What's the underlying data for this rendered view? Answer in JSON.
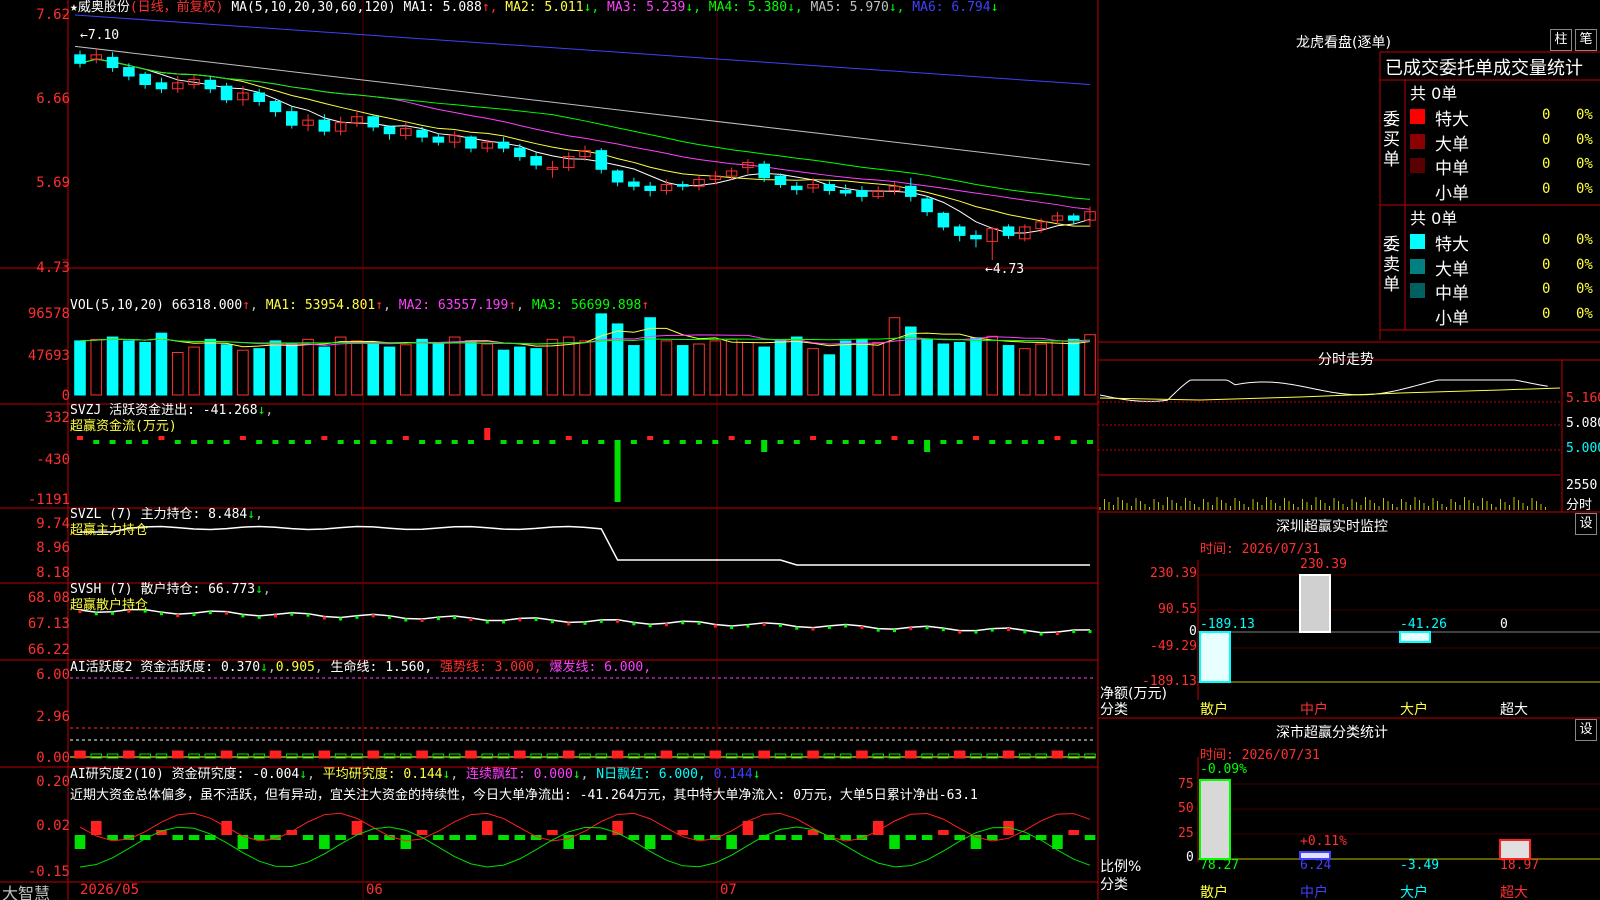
{
  "stock": {
    "star": "★",
    "name": "威奥股份",
    "period": "(日线，前复权)"
  },
  "ma_header": {
    "label": "MA(5,10,20,30,60,120)",
    "items": [
      {
        "k": "MA1:",
        "v": "5.088",
        "arrow": "↑",
        "color": "#ffffff"
      },
      {
        "k": "MA2:",
        "v": "5.011",
        "arrow": "↓",
        "color": "#ffff40"
      },
      {
        "k": "MA3:",
        "v": "5.239",
        "arrow": "↓",
        "color": "#ff40ff"
      },
      {
        "k": "MA4:",
        "v": "5.380",
        "arrow": "↓",
        "color": "#00ff00"
      },
      {
        "k": "MA5:",
        "v": "5.970",
        "arrow": "↓",
        "color": "#c0c0c0"
      },
      {
        "k": "MA6:",
        "v": "6.794",
        "arrow": "↓",
        "color": "#4040ff"
      }
    ]
  },
  "price_axis": [
    "7.62",
    "6.66",
    "5.69",
    "4.73"
  ],
  "hi_marker": "←7.10",
  "lo_marker": "←4.73",
  "vol_header": {
    "label": "VOL(5,10,20)",
    "v": "66318.000",
    "ma1": "MA1:  53954.801",
    "ma2": "MA2:  63557.199",
    "ma3": "MA3:  56699.898",
    "arrow": "↑"
  },
  "vol_axis": [
    "96578",
    "47693",
    "0"
  ],
  "svzj": {
    "title": "SVZJ  活跃资金进出: -41.268",
    "arrow": "↓",
    "sub": "超赢资金流(万元)",
    "axis": [
      "332",
      "-430",
      "-1191"
    ]
  },
  "svzl": {
    "title": "SVZL (7) 主力持仓: 8.484",
    "arrow": "↓",
    "sub": "超赢主力持仓",
    "axis": [
      "9.74",
      "8.96",
      "8.18"
    ]
  },
  "svsh": {
    "title": "SVSH (7) 散户持仓: 66.773",
    "arrow": "↓",
    "sub": "超赢散户持仓",
    "axis": [
      "68.08",
      "67.13",
      "66.22"
    ]
  },
  "ai1": {
    "title": "AI活跃度2 资金活跃度: 0.370",
    "a1": "↓",
    "v2": "0.905",
    "t3": "生命线: 1.560,",
    "t4": "强势线: 3.000,",
    "t5": "爆发线: 6.000,",
    "axis": [
      "6.00",
      "2.96",
      "0.00"
    ]
  },
  "ai2": {
    "title": "AI研究度2(10) 资金研究度: -0.004",
    "a1": "↓",
    "t2": "平均研究度: 0.144",
    "a2": "↓",
    "t3": "连续飘红: 0.000",
    "a3": "↓",
    "t4": "N日飘红: 6.000,",
    "t5": "0.144",
    "a5": "↓",
    "text": "近期大资金总体偏多，虽不活跃，但有异动，宜关注大资金的持续性，今日大单净流出: -41.264万元，其中特大单净流入: 0万元，大单5日累计净出-63.1",
    "axis": [
      "0.20",
      "0.02",
      "-0.15"
    ]
  },
  "dates": [
    "2026/05",
    "06",
    "07"
  ],
  "brand": "大智慧",
  "lhb": {
    "title": "龙虎看盘(逐单)",
    "btn1": "柱",
    "btn2": "笔",
    "heading": "已成交委托单成交量统计",
    "buy": {
      "label": "委买单",
      "total": "共 0单",
      "rows": [
        {
          "n": "特大",
          "c": "#ff0000",
          "q": "0",
          "p": "0%"
        },
        {
          "n": "大单",
          "c": "#8b0000",
          "q": "0",
          "p": "0%"
        },
        {
          "n": "中单",
          "c": "#5a0000",
          "q": "0",
          "p": "0%"
        },
        {
          "n": "小单",
          "c": "#000000",
          "q": "0",
          "p": "0%"
        }
      ]
    },
    "sell": {
      "label": "委卖单",
      "total": "共 0单",
      "rows": [
        {
          "n": "特大",
          "c": "#00ffff",
          "q": "0",
          "p": "0%"
        },
        {
          "n": "大单",
          "c": "#008080",
          "q": "0",
          "p": "0%"
        },
        {
          "n": "中单",
          "c": "#006060",
          "q": "0",
          "p": "0%"
        },
        {
          "n": "小单",
          "c": "#000000",
          "q": "0",
          "p": "0%"
        }
      ]
    }
  },
  "intraday": {
    "title": "分时走势",
    "axis": [
      "5.160",
      "5.080",
      "5.000"
    ],
    "vol": "2550",
    "vol_unit": "分时"
  },
  "monitor": {
    "title": "深圳超赢实时监控",
    "btn": "设",
    "time": "时间: 2026/07/31",
    "axis": [
      "230.39",
      "90.55",
      "0",
      "-49.29",
      "-189.13"
    ],
    "unit1": "净额(万元)",
    "unit2": "分类",
    "bars": [
      {
        "cat": "散户",
        "v": "-189.13"
      },
      {
        "cat": "中户",
        "v": "230.39"
      },
      {
        "cat": "大户",
        "v": "-41.26"
      },
      {
        "cat": "超大",
        "v": "0"
      }
    ]
  },
  "stat": {
    "title": "深市超赢分类统计",
    "btn": "设",
    "time": "时间: 2026/07/31",
    "axis": [
      "75",
      "50",
      "25",
      "0"
    ],
    "unit1": "比例%",
    "unit2": "分类",
    "top": [
      "-0.09%",
      "+0.11%"
    ],
    "bars": [
      {
        "cat": "散户",
        "v": "78.27"
      },
      {
        "cat": "中户",
        "v": "6.24"
      },
      {
        "cat": "大户",
        "v": "-3.49"
      },
      {
        "cat": "超大",
        "v": "18.97"
      }
    ]
  },
  "colors": {
    "up": "#ff3030",
    "down": "#00ffff",
    "grid": "#c00000",
    "ma1": "#ffffff",
    "ma2": "#ffff40",
    "ma3": "#ff40ff",
    "ma4": "#00ff00",
    "ma5": "#c0c0c0",
    "ma6": "#4040ff"
  },
  "chart_data": {
    "type": "candlestick",
    "title": "威奥股份",
    "ylim": [
      4.73,
      7.62
    ],
    "candles": [
      {
        "o": 7.15,
        "c": 7.05,
        "h": 7.2,
        "l": 7.0
      },
      {
        "o": 7.1,
        "c": 7.15,
        "h": 7.22,
        "l": 7.05
      },
      {
        "o": 7.12,
        "c": 7.0,
        "h": 7.18,
        "l": 6.95
      },
      {
        "o": 7.0,
        "c": 6.9,
        "h": 7.05,
        "l": 6.85
      },
      {
        "o": 6.92,
        "c": 6.8,
        "h": 6.95,
        "l": 6.75
      },
      {
        "o": 6.82,
        "c": 6.75,
        "h": 6.88,
        "l": 6.7
      },
      {
        "o": 6.75,
        "c": 6.82,
        "h": 6.9,
        "l": 6.7
      },
      {
        "o": 6.8,
        "c": 6.86,
        "h": 6.92,
        "l": 6.75
      },
      {
        "o": 6.85,
        "c": 6.75,
        "h": 6.9,
        "l": 6.7
      },
      {
        "o": 6.78,
        "c": 6.62,
        "h": 6.82,
        "l": 6.58
      },
      {
        "o": 6.62,
        "c": 6.7,
        "h": 6.78,
        "l": 6.55
      },
      {
        "o": 6.7,
        "c": 6.6,
        "h": 6.75,
        "l": 6.55
      },
      {
        "o": 6.6,
        "c": 6.48,
        "h": 6.62,
        "l": 6.42
      },
      {
        "o": 6.48,
        "c": 6.32,
        "h": 6.55,
        "l": 6.28
      },
      {
        "o": 6.32,
        "c": 6.38,
        "h": 6.45,
        "l": 6.25
      },
      {
        "o": 6.38,
        "c": 6.25,
        "h": 6.45,
        "l": 6.2
      },
      {
        "o": 6.25,
        "c": 6.35,
        "h": 6.42,
        "l": 6.2
      },
      {
        "o": 6.35,
        "c": 6.42,
        "h": 6.5,
        "l": 6.3
      },
      {
        "o": 6.42,
        "c": 6.3,
        "h": 6.45,
        "l": 6.25
      },
      {
        "o": 6.3,
        "c": 6.22,
        "h": 6.32,
        "l": 6.15
      },
      {
        "o": 6.2,
        "c": 6.28,
        "h": 6.35,
        "l": 6.15
      },
      {
        "o": 6.26,
        "c": 6.18,
        "h": 6.3,
        "l": 6.12
      },
      {
        "o": 6.18,
        "c": 6.12,
        "h": 6.22,
        "l": 6.08
      },
      {
        "o": 6.12,
        "c": 6.2,
        "h": 6.25,
        "l": 6.05
      },
      {
        "o": 6.18,
        "c": 6.05,
        "h": 6.2,
        "l": 6.0
      },
      {
        "o": 6.05,
        "c": 6.12,
        "h": 6.15,
        "l": 6.0
      },
      {
        "o": 6.12,
        "c": 6.05,
        "h": 6.18,
        "l": 6.0
      },
      {
        "o": 6.05,
        "c": 5.95,
        "h": 6.1,
        "l": 5.9
      },
      {
        "o": 5.95,
        "c": 5.85,
        "h": 6.0,
        "l": 5.8
      },
      {
        "o": 5.8,
        "c": 5.82,
        "h": 5.9,
        "l": 5.7
      },
      {
        "o": 5.82,
        "c": 5.95,
        "h": 6.0,
        "l": 5.78
      },
      {
        "o": 5.95,
        "c": 6.02,
        "h": 6.08,
        "l": 5.9
      },
      {
        "o": 6.02,
        "c": 5.8,
        "h": 6.05,
        "l": 5.75
      },
      {
        "o": 5.78,
        "c": 5.65,
        "h": 5.8,
        "l": 5.6
      },
      {
        "o": 5.65,
        "c": 5.6,
        "h": 5.7,
        "l": 5.55
      },
      {
        "o": 5.6,
        "c": 5.55,
        "h": 5.65,
        "l": 5.48
      },
      {
        "o": 5.55,
        "c": 5.62,
        "h": 5.68,
        "l": 5.5
      },
      {
        "o": 5.62,
        "c": 5.6,
        "h": 5.66,
        "l": 5.55
      },
      {
        "o": 5.6,
        "c": 5.68,
        "h": 5.72,
        "l": 5.55
      },
      {
        "o": 5.68,
        "c": 5.72,
        "h": 5.78,
        "l": 5.62
      },
      {
        "o": 5.72,
        "c": 5.78,
        "h": 5.82,
        "l": 5.68
      },
      {
        "o": 5.82,
        "c": 5.88,
        "h": 5.92,
        "l": 5.75
      },
      {
        "o": 5.86,
        "c": 5.7,
        "h": 5.9,
        "l": 5.65
      },
      {
        "o": 5.72,
        "c": 5.62,
        "h": 5.75,
        "l": 5.58
      },
      {
        "o": 5.6,
        "c": 5.56,
        "h": 5.65,
        "l": 5.5
      },
      {
        "o": 5.58,
        "c": 5.62,
        "h": 5.7,
        "l": 5.52
      },
      {
        "o": 5.62,
        "c": 5.55,
        "h": 5.66,
        "l": 5.5
      },
      {
        "o": 5.55,
        "c": 5.52,
        "h": 5.62,
        "l": 5.48
      },
      {
        "o": 5.55,
        "c": 5.48,
        "h": 5.6,
        "l": 5.42
      },
      {
        "o": 5.48,
        "c": 5.55,
        "h": 5.6,
        "l": 5.45
      },
      {
        "o": 5.55,
        "c": 5.6,
        "h": 5.65,
        "l": 5.5
      },
      {
        "o": 5.6,
        "c": 5.48,
        "h": 5.7,
        "l": 5.42
      },
      {
        "o": 5.45,
        "c": 5.3,
        "h": 5.48,
        "l": 5.25
      },
      {
        "o": 5.28,
        "c": 5.12,
        "h": 5.3,
        "l": 5.08
      },
      {
        "o": 5.12,
        "c": 5.02,
        "h": 5.15,
        "l": 4.95
      },
      {
        "o": 5.02,
        "c": 4.98,
        "h": 5.08,
        "l": 4.88
      },
      {
        "o": 4.95,
        "c": 5.1,
        "h": 5.12,
        "l": 4.73
      },
      {
        "o": 5.12,
        "c": 5.02,
        "h": 5.15,
        "l": 4.98
      },
      {
        "o": 4.98,
        "c": 5.12,
        "h": 5.15,
        "l": 4.95
      },
      {
        "o": 5.1,
        "c": 5.18,
        "h": 5.22,
        "l": 5.05
      },
      {
        "o": 5.2,
        "c": 5.25,
        "h": 5.3,
        "l": 5.15
      },
      {
        "o": 5.25,
        "c": 5.2,
        "h": 5.28,
        "l": 5.15
      },
      {
        "o": 5.2,
        "c": 5.3,
        "h": 5.36,
        "l": 5.12
      }
    ],
    "volume": [
      70,
      72,
      75,
      70,
      68,
      80,
      55,
      62,
      72,
      65,
      58,
      60,
      70,
      66,
      72,
      62,
      75,
      70,
      68,
      62,
      65,
      72,
      68,
      75,
      70,
      66,
      58,
      62,
      60,
      72,
      75,
      70,
      105,
      92,
      64,
      100,
      70,
      64,
      66,
      70,
      72,
      68,
      62,
      70,
      75,
      60,
      52,
      70,
      72,
      68,
      100,
      88,
      72,
      66,
      68,
      74,
      76,
      64,
      60,
      66,
      70,
      72,
      78
    ],
    "y_axes": {
      "price": [
        4.73,
        7.62
      ],
      "volume": [
        0,
        96578
      ]
    }
  }
}
